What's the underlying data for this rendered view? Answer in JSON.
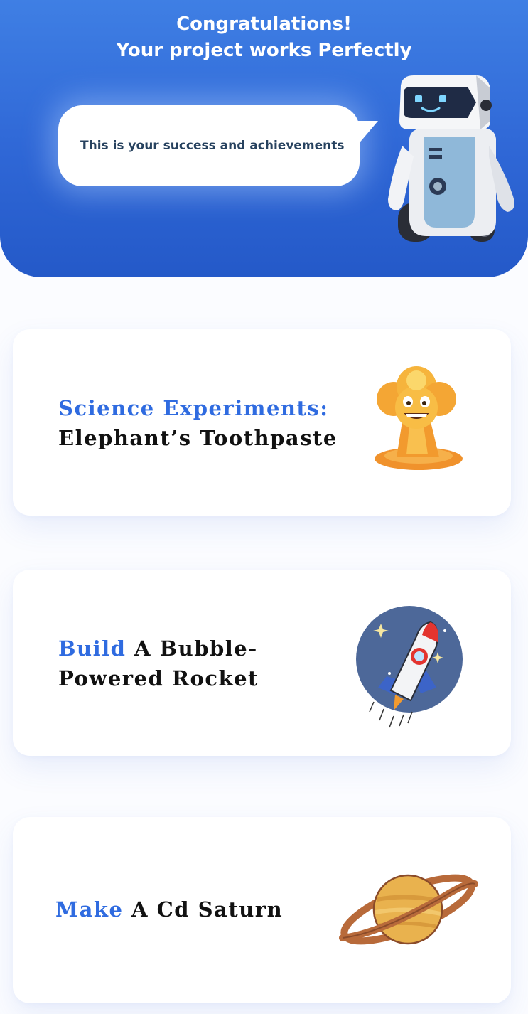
{
  "header": {
    "title_line1": "Congratulations!",
    "title_line2": "Your project works Perfectly",
    "bubble_text": "This is your success and achievements"
  },
  "cards": [
    {
      "title_accent": "Science Experiments:",
      "title_rest": "Elephant’s Toothpaste",
      "icon": "explosion-mascot-icon"
    },
    {
      "title_accent": "Build",
      "title_rest": " A Bubble-Powered Rocket",
      "icon": "rocket-icon"
    },
    {
      "title_accent": "Make",
      "title_rest": " A Cd Saturn",
      "icon": "saturn-icon"
    }
  ],
  "colors": {
    "header_bg": "#2f67d6",
    "accent": "#2f6be0",
    "card_bg": "#ffffff",
    "page_bg": "#fbfcff"
  }
}
